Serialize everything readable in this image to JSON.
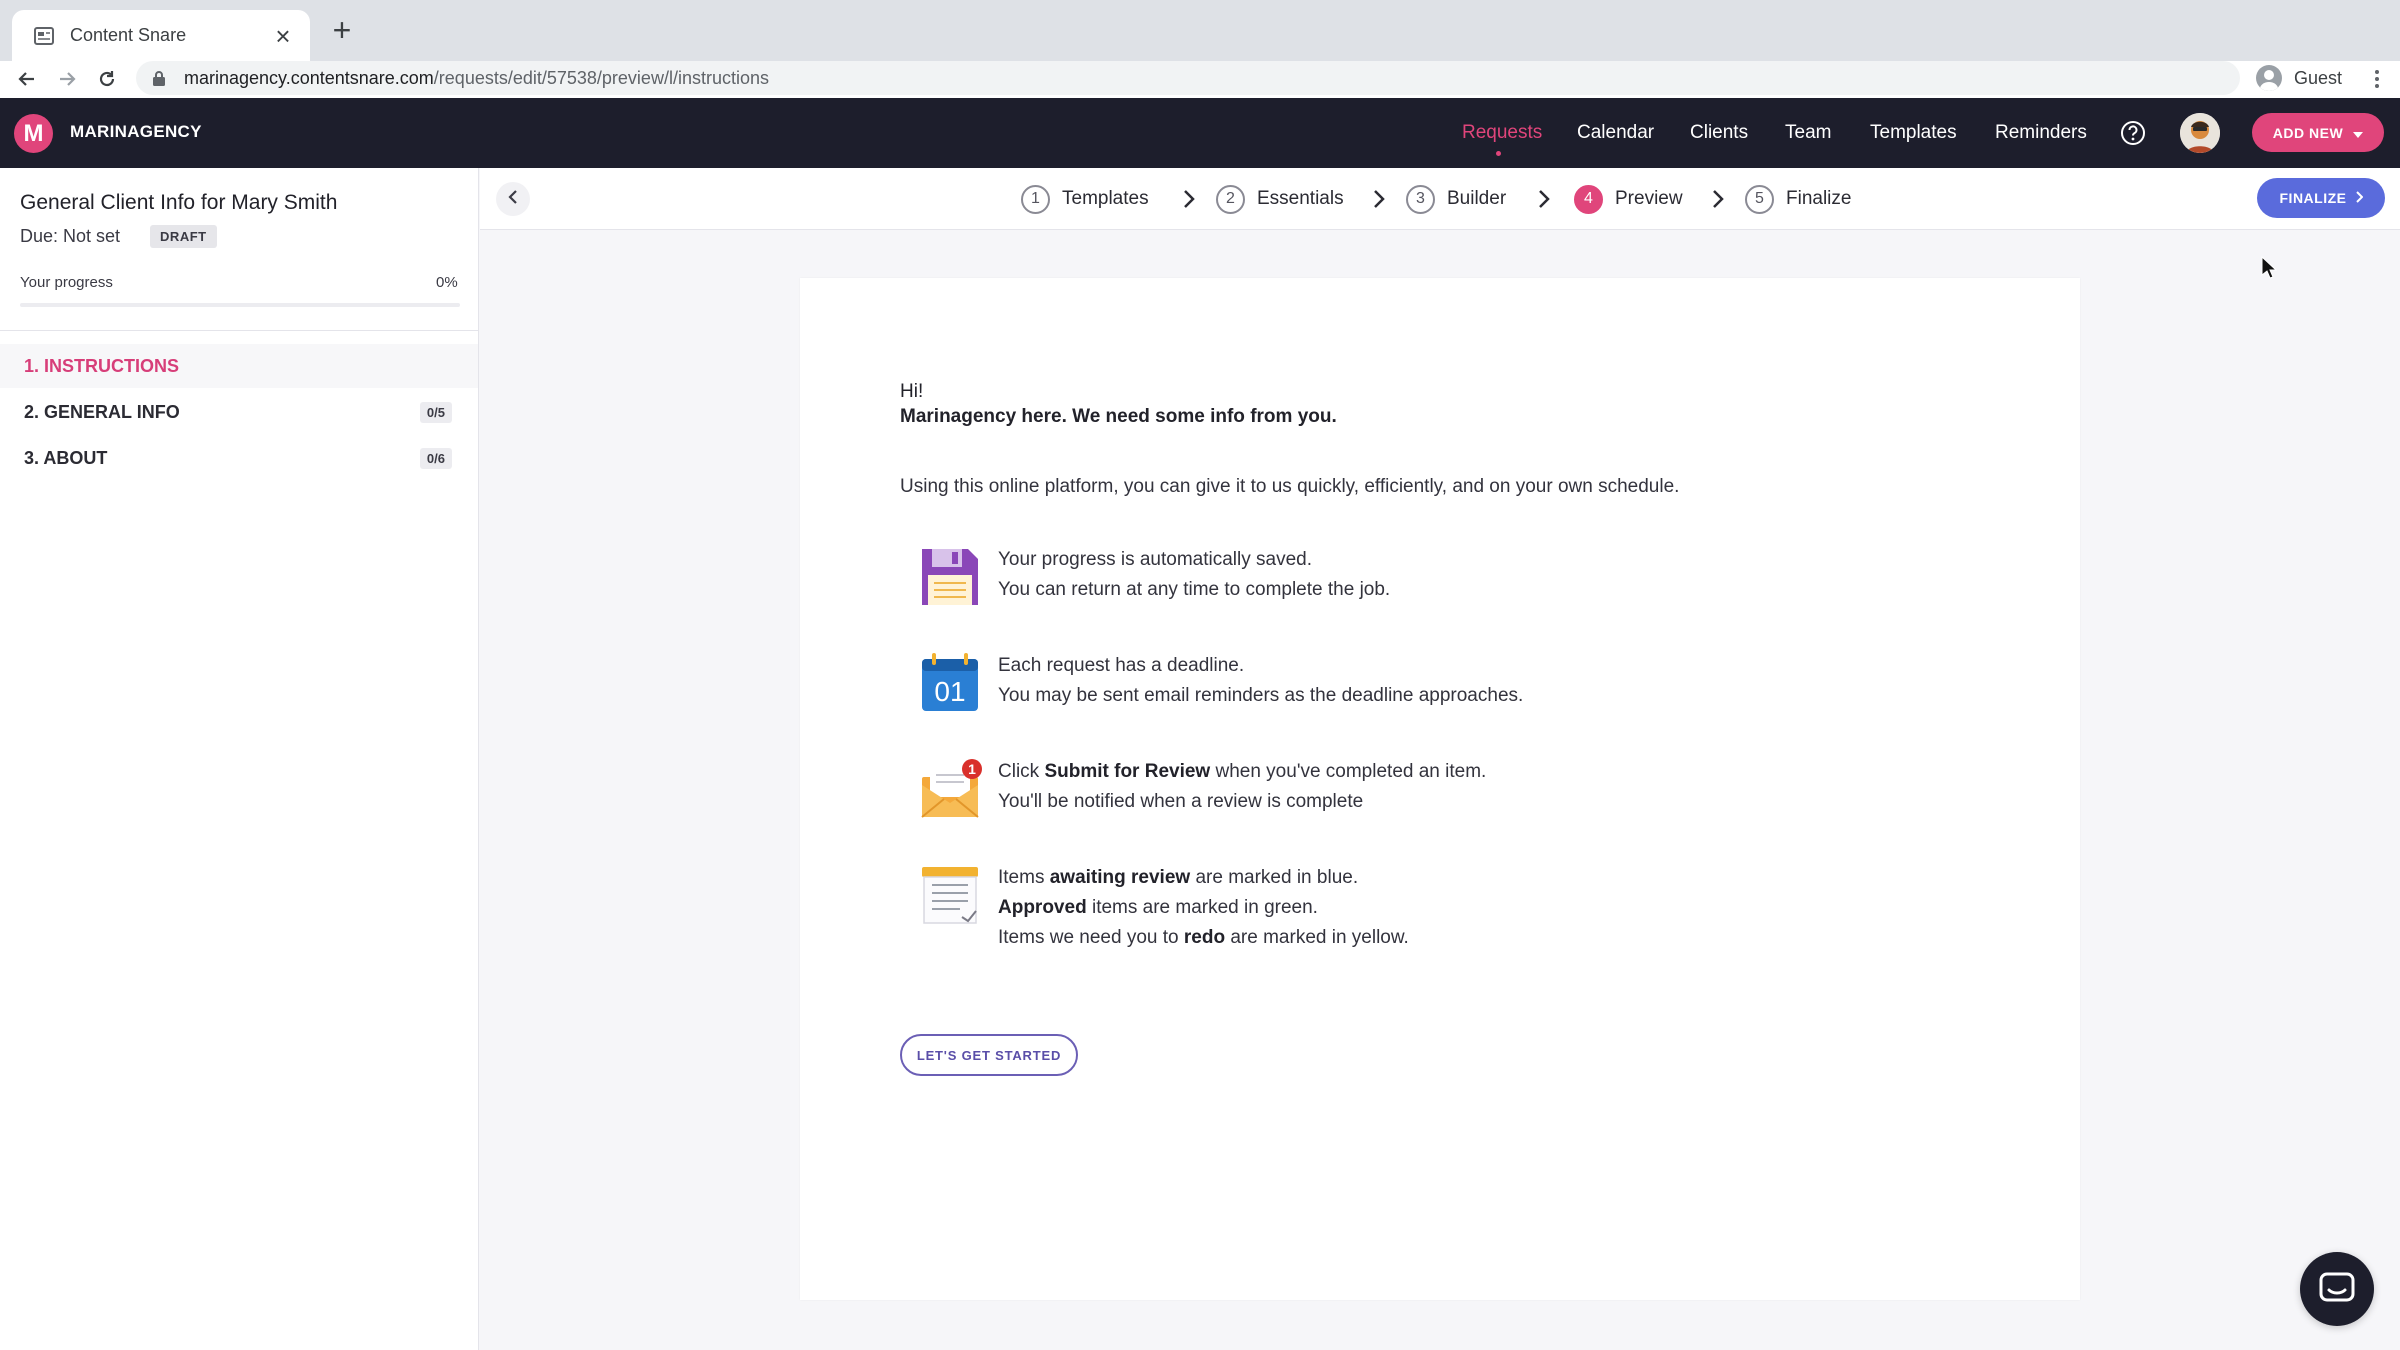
{
  "browser": {
    "tab_title": "Content Snare",
    "url_host": "marinagency.contentsnare.com",
    "url_path": "/requests/edit/57538/preview/l/instructions",
    "profile_label": "Guest"
  },
  "header": {
    "brand_initial": "M",
    "brand_name": "MARINAGENCY",
    "nav": [
      "Requests",
      "Calendar",
      "Clients",
      "Team",
      "Templates",
      "Reminders"
    ],
    "active_nav": "Requests",
    "add_new_label": "ADD NEW",
    "accent_color": "#e0457b"
  },
  "sidebar": {
    "request_title": "General Client Info for Mary Smith",
    "due_text": "Due: Not set",
    "status_badge": "DRAFT",
    "progress_label": "Your progress",
    "progress_value": "0%",
    "progress_fraction": 0,
    "sections": [
      {
        "label": "1. INSTRUCTIONS",
        "count": "",
        "active": true
      },
      {
        "label": "2. GENERAL INFO",
        "count": "0/5",
        "active": false
      },
      {
        "label": "3. ABOUT",
        "count": "0/6",
        "active": false
      }
    ]
  },
  "stepper": {
    "steps": [
      {
        "num": "1",
        "label": "Templates"
      },
      {
        "num": "2",
        "label": "Essentials"
      },
      {
        "num": "3",
        "label": "Builder"
      },
      {
        "num": "4",
        "label": "Preview"
      },
      {
        "num": "5",
        "label": "Finalize"
      }
    ],
    "active_step": "4",
    "finalize_label": "FINALIZE",
    "finalize_color": "#5a6bdc"
  },
  "content": {
    "greeting_line1": "Hi!",
    "greeting_line2": "Marinagency here. We need some info from you.",
    "intro": "Using this online platform, you can give it to us quickly, efficiently, and on your own schedule.",
    "autosave": {
      "line1": "Your progress is automatically saved.",
      "line2": "You can return at any time to complete the job."
    },
    "deadline": {
      "line1": "Each request has a deadline.",
      "line2": "You may be sent email reminders as the deadline approaches.",
      "calendar_day": "01"
    },
    "submit": {
      "pre": "Click ",
      "bold": "Submit for Review",
      "post": " when you've completed an item.",
      "line2": "You'll be notified when a review is complete",
      "badge": "1"
    },
    "status": {
      "l1_pre": "Items ",
      "l1_bold": "awaiting review",
      "l1_post": " are marked in blue.",
      "l2_bold": "Approved",
      "l2_post": " items are marked in green.",
      "l3_pre": "Items we need you to ",
      "l3_bold": "redo",
      "l3_post": " are marked in yellow."
    },
    "start_button": "LET'S GET STARTED"
  }
}
